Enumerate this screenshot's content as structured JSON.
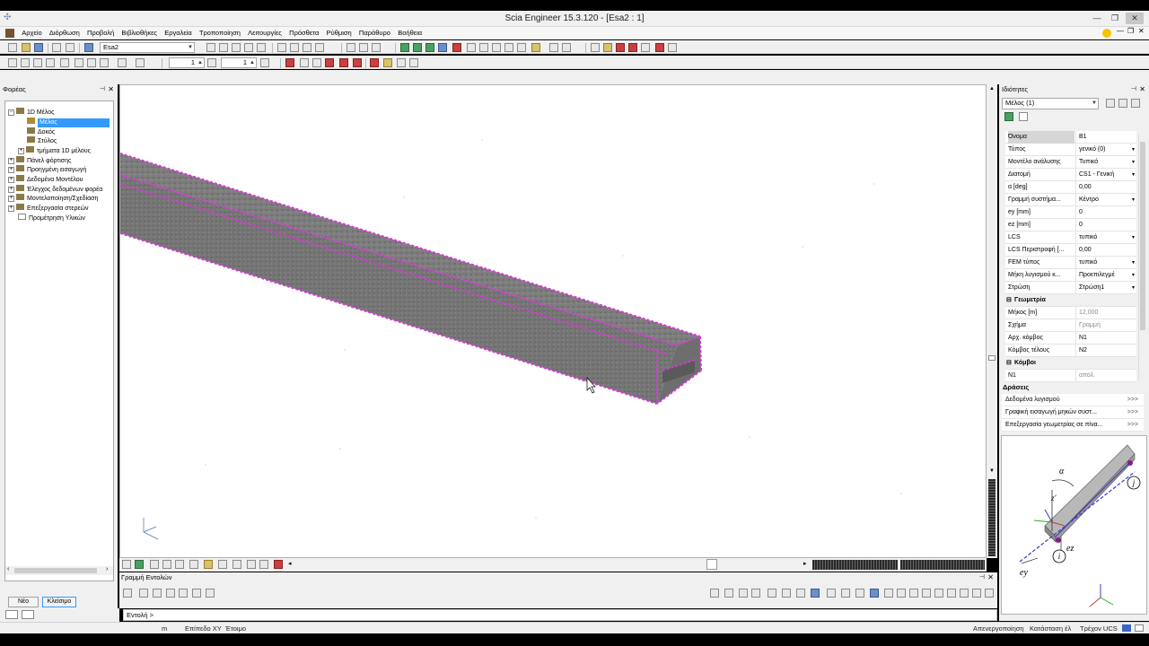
{
  "window": {
    "title": "Scia Engineer 15.3.120 - [Esa2 : 1]"
  },
  "menu": [
    "Αρχείο",
    "Διόρθωση",
    "Προβολή",
    "Βιβλιοθήκες",
    "Εργαλεία",
    "Τροποποίηση",
    "Λειτουργίες",
    "Πρόσθετα",
    "Ρύθμιση",
    "Παράθυρο",
    "Βοήθεια"
  ],
  "toolbar": {
    "project_combo": "Esa2",
    "spin1": "1",
    "spin2": "1"
  },
  "left_panel": {
    "title": "Φορέας",
    "tree": [
      {
        "label": "1D Μέλος",
        "level": 0,
        "exp": "−"
      },
      {
        "label": "Μέλος",
        "level": 1,
        "selected": true
      },
      {
        "label": "Δοκός",
        "level": 1
      },
      {
        "label": "Στύλος",
        "level": 1
      },
      {
        "label": "τμήματα 1D μέλους",
        "level": 1,
        "exp": "+"
      },
      {
        "label": "Πάνελ φόρτισης",
        "level": 0,
        "exp": "+"
      },
      {
        "label": "Προηγμένη εισαγωγή",
        "level": 0,
        "exp": "+"
      },
      {
        "label": "Δεδομένα Μοντέλου",
        "level": 0,
        "exp": "+"
      },
      {
        "label": "Έλεγχος δεδομένων φορέα",
        "level": 0,
        "exp": "+"
      },
      {
        "label": "Μοντελοποίηση/Σχεδίαση",
        "level": 0,
        "exp": "+"
      },
      {
        "label": "Επεξεργασία στερεών",
        "level": 0,
        "exp": "+"
      },
      {
        "label": "Προμέτρηση Υλικών",
        "level": 0
      }
    ],
    "buttons": {
      "new": "Νέο",
      "close": "Κλείσιμο"
    }
  },
  "command_panel": {
    "title": "Γραμμή Εντολών",
    "prompt": "Εντολή >"
  },
  "status": {
    "unit": "m",
    "plane": "Επίπεδο XY",
    "ready": "Έτοιμο",
    "snap": "Απενεργοποίηση",
    "state": "Κατάσταση έλ",
    "ucs": "Τρέχον UCS"
  },
  "properties": {
    "title": "Ιδιότητες",
    "selector": "Μέλος (1)",
    "rows": [
      {
        "k": "Όνομα",
        "v": "B1",
        "sel": true
      },
      {
        "k": "Τύπος",
        "v": "γενικό (0)",
        "dd": true
      },
      {
        "k": "Μοντέλο ανάλυσης",
        "v": "Τυπικό",
        "dd": true
      },
      {
        "k": "Διατομή",
        "v": "CS1 - Γενική",
        "dd": true
      },
      {
        "k": "α [deg]",
        "v": "0,00"
      },
      {
        "k": "Γραμμή συστήμα...",
        "v": "Κέντρο",
        "dd": true
      },
      {
        "k": "ey [mm]",
        "v": "0"
      },
      {
        "k": "ez [mm]",
        "v": "0"
      },
      {
        "k": "LCS",
        "v": "τυπικό",
        "dd": true
      },
      {
        "k": "LCS Περιστροφή [...",
        "v": "0,00"
      },
      {
        "k": "FEM τύπος",
        "v": "τυπικό",
        "dd": true
      },
      {
        "k": "Μήκη λυγισμού κ...",
        "v": "Προεπιλεγμέ",
        "dd": true
      },
      {
        "k": "Στρώση",
        "v": "Στρώση1",
        "dd": true
      },
      {
        "k": "Γεωμετρία",
        "group": true
      },
      {
        "k": "Μήκος [m]",
        "v": "12,000",
        "grey": true
      },
      {
        "k": "Σχήμα",
        "v": "Γραμμή",
        "grey": true
      },
      {
        "k": "Αρχ. κόμβος",
        "v": "N1"
      },
      {
        "k": "Κόμβος τέλους",
        "v": "N2"
      },
      {
        "k": "Κόμβοι",
        "group": true
      },
      {
        "k": "N1",
        "v": "απολ.",
        "grey": true
      }
    ],
    "actions_title": "Δράσεις",
    "actions": [
      "Δεδομένα λυγισμού",
      "Γραφική εισαγωγή μηκών συστ...",
      "Επεξεργασία γεωμετρίας σε πίνα..."
    ],
    "action_arrow": ">>>",
    "preview": {
      "alpha": "α",
      "z": "z'",
      "j": "j",
      "i": "i",
      "ez": "ez",
      "ey": "ey"
    }
  }
}
